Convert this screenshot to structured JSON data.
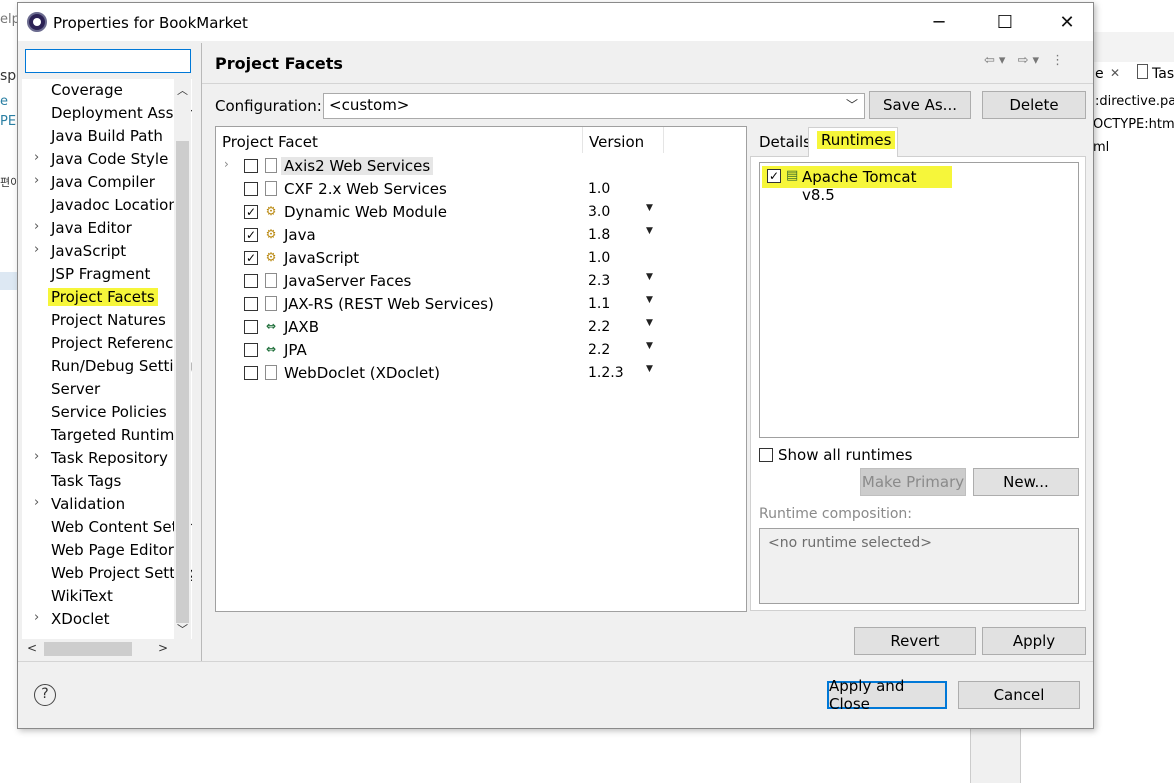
{
  "dialog": {
    "title": "Properties for BookMarket",
    "filter_value": "",
    "tree": [
      {
        "label": "Coverage",
        "chevron": false
      },
      {
        "label": "Deployment Assembly",
        "chevron": false
      },
      {
        "label": "Java Build Path",
        "chevron": false
      },
      {
        "label": "Java Code Style",
        "chevron": true
      },
      {
        "label": "Java Compiler",
        "chevron": true
      },
      {
        "label": "Javadoc Location",
        "chevron": false
      },
      {
        "label": "Java Editor",
        "chevron": true
      },
      {
        "label": "JavaScript",
        "chevron": true
      },
      {
        "label": "JSP Fragment",
        "chevron": false
      },
      {
        "label": "Project Facets",
        "chevron": false,
        "selected": true
      },
      {
        "label": "Project Natures",
        "chevron": false
      },
      {
        "label": "Project References",
        "chevron": false
      },
      {
        "label": "Run/Debug Settings",
        "chevron": false
      },
      {
        "label": "Server",
        "chevron": false
      },
      {
        "label": "Service Policies",
        "chevron": false
      },
      {
        "label": "Targeted Runtimes",
        "chevron": false
      },
      {
        "label": "Task Repository",
        "chevron": true
      },
      {
        "label": "Task Tags",
        "chevron": false
      },
      {
        "label": "Validation",
        "chevron": true
      },
      {
        "label": "Web Content Settings",
        "chevron": false
      },
      {
        "label": "Web Page Editor",
        "chevron": false
      },
      {
        "label": "Web Project Settings",
        "chevron": false
      },
      {
        "label": "WikiText",
        "chevron": false
      },
      {
        "label": "XDoclet",
        "chevron": true
      }
    ]
  },
  "page": {
    "title": "Project Facets",
    "configuration_label": "Configuration:",
    "configuration_value": "<custom>",
    "save_as": "Save As...",
    "delete": "Delete",
    "col_facet": "Project Facet",
    "col_version": "Version",
    "facets": [
      {
        "name": "Axis2 Web Services",
        "checked": false,
        "version": "",
        "dropdown": false,
        "expandable": true,
        "icon": "doc",
        "selected": true
      },
      {
        "name": "CXF 2.x Web Services",
        "checked": false,
        "version": "1.0",
        "dropdown": false,
        "icon": "doc"
      },
      {
        "name": "Dynamic Web Module",
        "checked": true,
        "version": "3.0",
        "dropdown": true,
        "icon": "mod"
      },
      {
        "name": "Java",
        "checked": true,
        "version": "1.8",
        "dropdown": true,
        "icon": "mod"
      },
      {
        "name": "JavaScript",
        "checked": true,
        "version": "1.0",
        "dropdown": false,
        "icon": "mod"
      },
      {
        "name": "JavaServer Faces",
        "checked": false,
        "version": "2.3",
        "dropdown": true,
        "icon": "doc"
      },
      {
        "name": "JAX-RS (REST Web Services)",
        "checked": false,
        "version": "1.1",
        "dropdown": true,
        "icon": "doc"
      },
      {
        "name": "JAXB",
        "checked": false,
        "version": "2.2",
        "dropdown": true,
        "icon": "xb"
      },
      {
        "name": "JPA",
        "checked": false,
        "version": "2.2",
        "dropdown": true,
        "icon": "xb"
      },
      {
        "name": "WebDoclet (XDoclet)",
        "checked": false,
        "version": "1.2.3",
        "dropdown": true,
        "icon": "doc"
      }
    ],
    "tab_details": "Details",
    "tab_runtimes": "Runtimes",
    "runtime": "Apache Tomcat v8.5",
    "show_all": "Show all runtimes",
    "make_primary": "Make Primary",
    "new": "New...",
    "composition_label": "Runtime composition:",
    "composition_value": "<no runtime selected>",
    "revert": "Revert",
    "apply": "Apply"
  },
  "footer": {
    "apply_close": "Apply and Close",
    "cancel": "Cancel",
    "help": "?"
  },
  "background": {
    "left_fragments": [
      "elp",
      "sp",
      "e",
      "PE",
      "편이"
    ],
    "right_tabs": [
      "e",
      "Tas"
    ],
    "right_code": [
      ":directive.pa",
      "OCTYPE:html",
      "ml"
    ]
  },
  "colors": {
    "highlight": "#f6f63a",
    "focus_blue": "#0078d7"
  }
}
